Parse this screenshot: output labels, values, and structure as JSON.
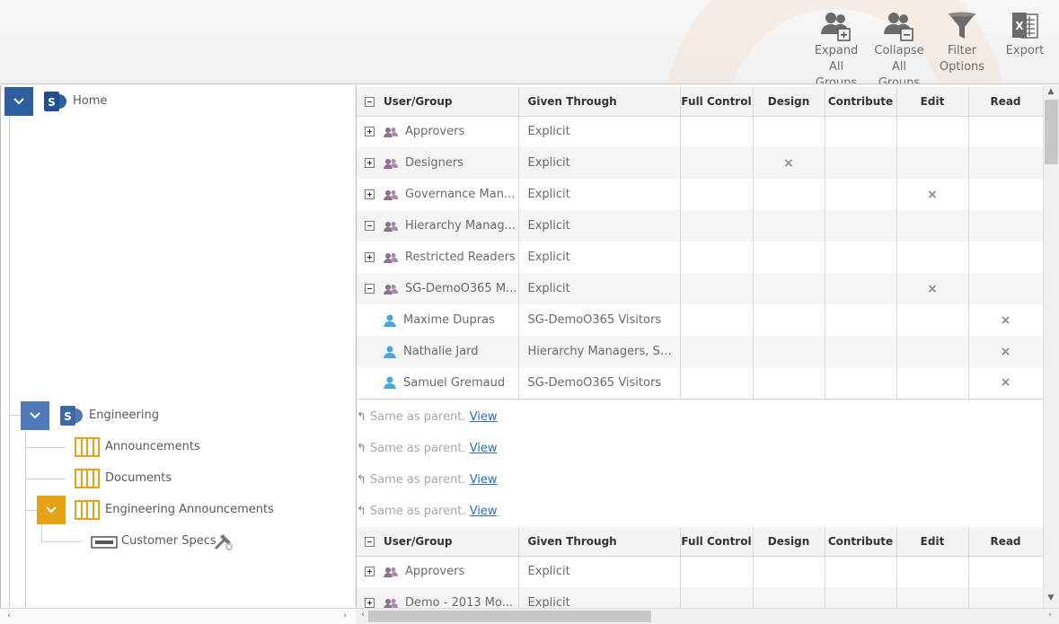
{
  "toolbar": {
    "expand": {
      "line1": "Expand All",
      "line2": "Groups"
    },
    "collapse": {
      "line1": "Collapse",
      "line2": "All Groups"
    },
    "filter": {
      "line1": "Filter",
      "line2": "Options"
    },
    "export": {
      "line1": "Export"
    }
  },
  "tree": {
    "home": "Home",
    "engineering": "Engineering",
    "announcements": "Announcements",
    "documents": "Documents",
    "eng_announcements": "Engineering Announcements",
    "customer_specs": "Customer Specs"
  },
  "table": {
    "headers": [
      "User/Group",
      "Given Through",
      "Full Control",
      "Design",
      "Contribute",
      "Edit",
      "Read"
    ]
  },
  "home_rows": [
    {
      "name": "Approvers",
      "given": "Explicit"
    },
    {
      "name": "Designers",
      "given": "Explicit"
    },
    {
      "name": "Governance Man...",
      "given": "Explicit"
    },
    {
      "name": "Hierarchy Manag...",
      "given": "Explicit"
    },
    {
      "name": "Restricted Readers",
      "given": "Explicit"
    },
    {
      "name": "SG-DemoO365 M...",
      "given": "Explicit"
    },
    {
      "name": "Maxime Dupras",
      "given": "SG-DemoO365 Visitors"
    },
    {
      "name": "Nathalie Jard",
      "given": "Hierarchy Managers, SG-..."
    },
    {
      "name": "Samuel Gremaud",
      "given": "SG-DemoO365 Visitors"
    }
  ],
  "same_as_parent": {
    "text": "Same as parent.",
    "link": "View"
  },
  "spec_rows": [
    {
      "name": "Approvers",
      "given": "Explicit"
    },
    {
      "name": "Demo - 2013 Mo...",
      "given": "Explicit"
    }
  ],
  "marks": {
    "x": "×"
  },
  "colors": {
    "tree_toggle": "#2d5f9e",
    "lib_orange": "#e6a117",
    "group_icon": "#8e6e8f",
    "user_icon": "#4aa6e0",
    "link": "#2a6ebb"
  }
}
